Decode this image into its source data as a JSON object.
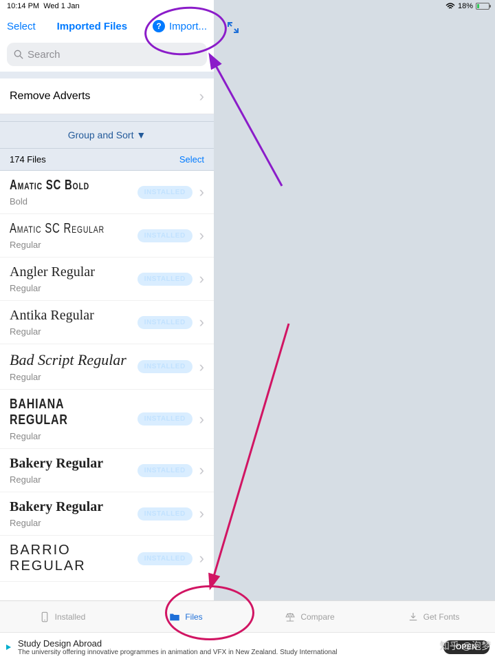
{
  "status": {
    "time": "10:14 PM",
    "date": "Wed 1 Jan",
    "battery": "18%"
  },
  "topbar": {
    "select": "Select",
    "title": "Imported Files",
    "import": "Import..."
  },
  "search": {
    "placeholder": "Search"
  },
  "remove": {
    "label": "Remove Adverts"
  },
  "sort": {
    "label": "Group and Sort ▼"
  },
  "count": {
    "label": "174 Files",
    "select": "Select"
  },
  "badge": "INSTALLED",
  "fonts": [
    {
      "name": "Amatic SC Bold",
      "sub": "Bold",
      "cls": "f-amatic f-amaticb"
    },
    {
      "name": "Amatic SC Regular",
      "sub": "Regular",
      "cls": "f-amatic"
    },
    {
      "name": "Angler Regular",
      "sub": "Regular",
      "cls": "f-script"
    },
    {
      "name": "Antika Regular",
      "sub": "Regular",
      "cls": "f-cursive"
    },
    {
      "name": "Bad Script Regular",
      "sub": "Regular",
      "cls": "f-bad"
    },
    {
      "name": "BAHIANA REGULAR",
      "sub": "Regular",
      "cls": "f-bahiana"
    },
    {
      "name": "Bakery Regular",
      "sub": "Regular",
      "cls": "f-bakery"
    },
    {
      "name": "Bakery Regular",
      "sub": "Regular",
      "cls": "f-bakery"
    },
    {
      "name": "BARRIO REGULAR",
      "sub": "",
      "cls": "f-barrio"
    }
  ],
  "tabs": {
    "installed": "Installed",
    "files": "Files",
    "compare": "Compare",
    "getfonts": "Get Fonts"
  },
  "ad": {
    "title": "Study Design Abroad",
    "body": "The university offering innovative programmes in animation and VFX in New Zealand. Study International",
    "cta": "OPEN"
  },
  "watermark": "知乎 @泡梦"
}
